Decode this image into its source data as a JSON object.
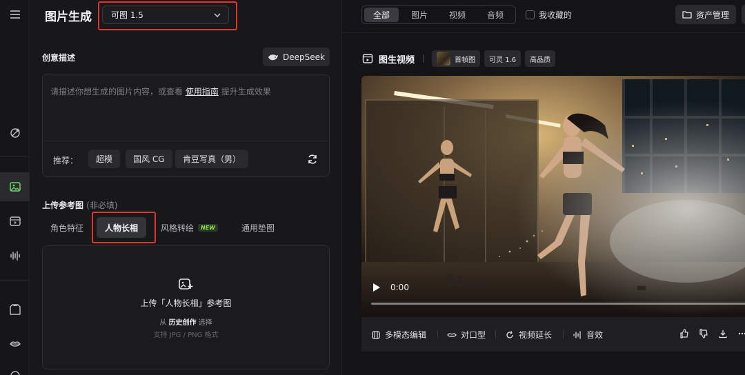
{
  "app": {
    "title": "图片生成",
    "model_selected": "可图 1.5"
  },
  "rail": {
    "icons": [
      "magic-tag-icon",
      "image-icon",
      "video-icon",
      "audio-wave-icon",
      "shirt-icon",
      "lips-icon"
    ]
  },
  "prompt_section": {
    "label": "创意描述",
    "deepseek_label": "DeepSeek",
    "placeholder_before": "请描述你想生成的图片内容，或查看",
    "placeholder_link": "使用指南",
    "placeholder_after": "提升生成效果",
    "recommend_label": "推荐：",
    "chips": [
      "超模",
      "国风 CG",
      "肯豆写真（男）"
    ]
  },
  "reference_section": {
    "label": "上传参考图",
    "optional": "(非必填)",
    "tabs": [
      {
        "label": "角色特征"
      },
      {
        "label": "人物长相",
        "active": true
      },
      {
        "label": "风格转绘",
        "badge": "NEW"
      },
      {
        "label": "通用垫图"
      }
    ],
    "upload_title": "上传「人物长相」参考图",
    "from_prefix": "从",
    "from_link": "历史创作",
    "from_suffix": "选择",
    "hint": "支持 JPG / PNG 格式"
  },
  "topbar": {
    "filters": [
      "全部",
      "图片",
      "视频",
      "音频"
    ],
    "active_filter": "全部",
    "favorites_label": "我收藏的",
    "asset_button": "资产管理"
  },
  "video_card": {
    "title": "图生视频",
    "tags": [
      "首帧图",
      "可灵 1.6",
      "高品质"
    ],
    "time": "0:00",
    "progress": 0,
    "actions": [
      "多模态编辑",
      "对口型",
      "视频延长",
      "音效"
    ],
    "small_actions": [
      "thumbs-up-icon",
      "thumbs-down-icon",
      "download-icon",
      "more-icon"
    ]
  },
  "colors": {
    "highlight": "#e0362e",
    "new_badge": "#8fe05a",
    "background": "#18181b"
  }
}
